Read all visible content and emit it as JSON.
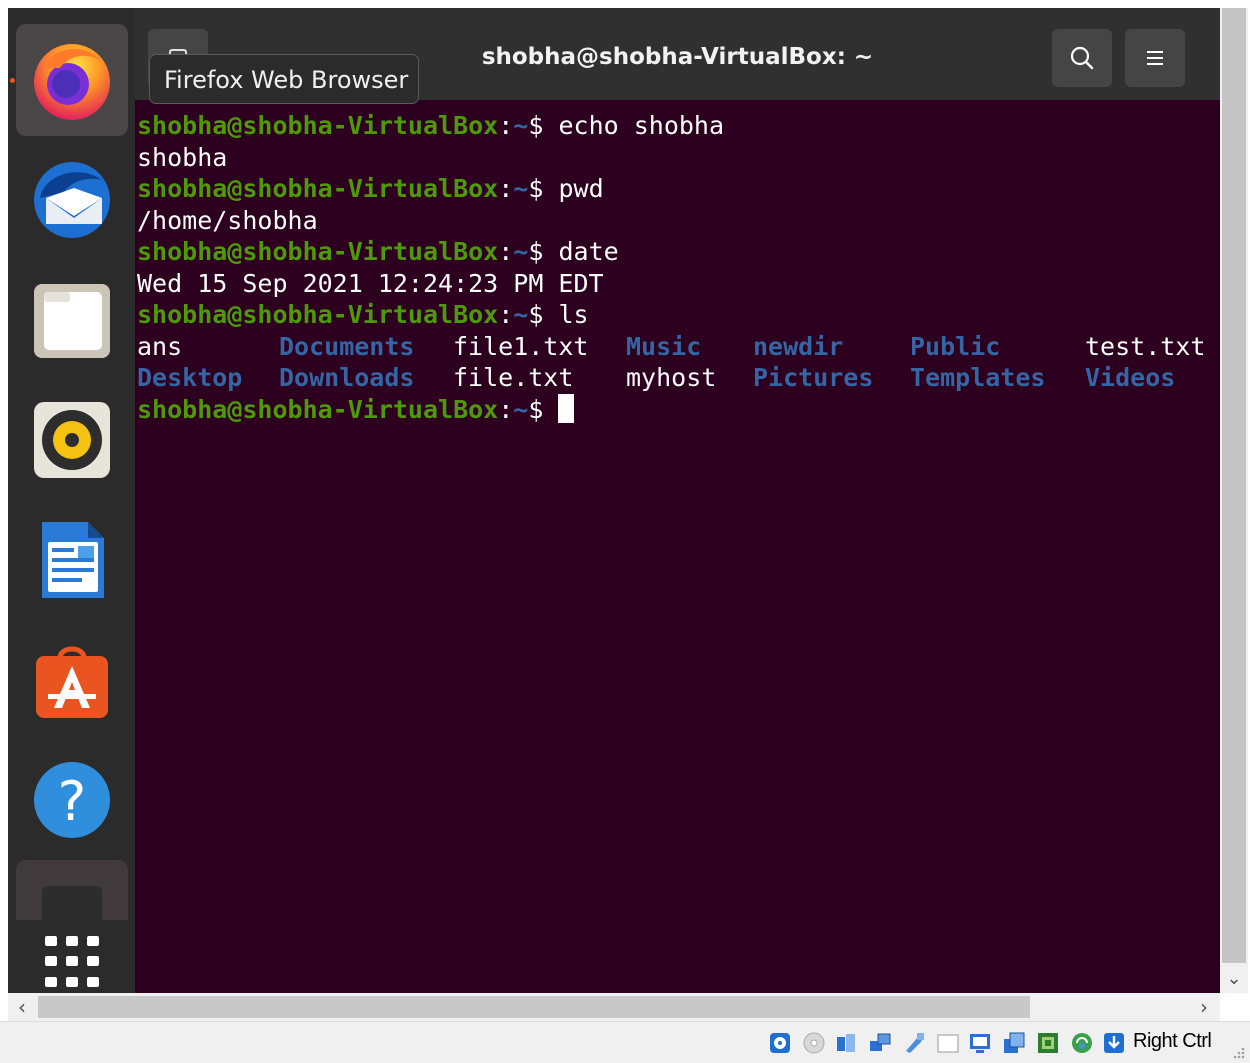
{
  "window": {
    "title": "shobha@shobha-VirtualBox: ~",
    "tooltip": "Firefox Web Browser"
  },
  "dock": {
    "items": [
      "firefox",
      "thunderbird",
      "files",
      "rhythmbox",
      "libreoffice-writer",
      "ubuntu-software",
      "help",
      "terminal"
    ],
    "show_apps_icon": "apps-grid-icon"
  },
  "terminal": {
    "prompt_user": "shobha@shobha-VirtualBox",
    "prompt_path": "~",
    "prompt_sep": ":",
    "prompt_symbol": "$",
    "lines": [
      {
        "command": "echo shobha"
      },
      {
        "output": "shobha"
      },
      {
        "command": "pwd"
      },
      {
        "output": "/home/shobha"
      },
      {
        "command": "date"
      },
      {
        "output": "Wed 15 Sep 2021 12:24:23 PM EDT"
      },
      {
        "command": "ls"
      }
    ],
    "ls_row1": [
      {
        "name": "ans",
        "dir": false
      },
      {
        "name": "Documents",
        "dir": true
      },
      {
        "name": "file1.txt",
        "dir": false
      },
      {
        "name": "Music",
        "dir": true
      },
      {
        "name": "newdir",
        "dir": true
      },
      {
        "name": "Public",
        "dir": true
      },
      {
        "name": "test.txt",
        "dir": false
      }
    ],
    "ls_row2": [
      {
        "name": "Desktop",
        "dir": true
      },
      {
        "name": "Downloads",
        "dir": true
      },
      {
        "name": "file.txt",
        "dir": false
      },
      {
        "name": "myhost",
        "dir": false
      },
      {
        "name": "Pictures",
        "dir": true
      },
      {
        "name": "Templates",
        "dir": true
      },
      {
        "name": "Videos",
        "dir": true
      }
    ]
  },
  "statusbar": {
    "host_key": "Right Ctrl"
  },
  "colors": {
    "terminal_bg": "#2c001e",
    "prompt_user": "#4e9a06",
    "prompt_path": "#3465a4",
    "directory": "#3465a4"
  }
}
